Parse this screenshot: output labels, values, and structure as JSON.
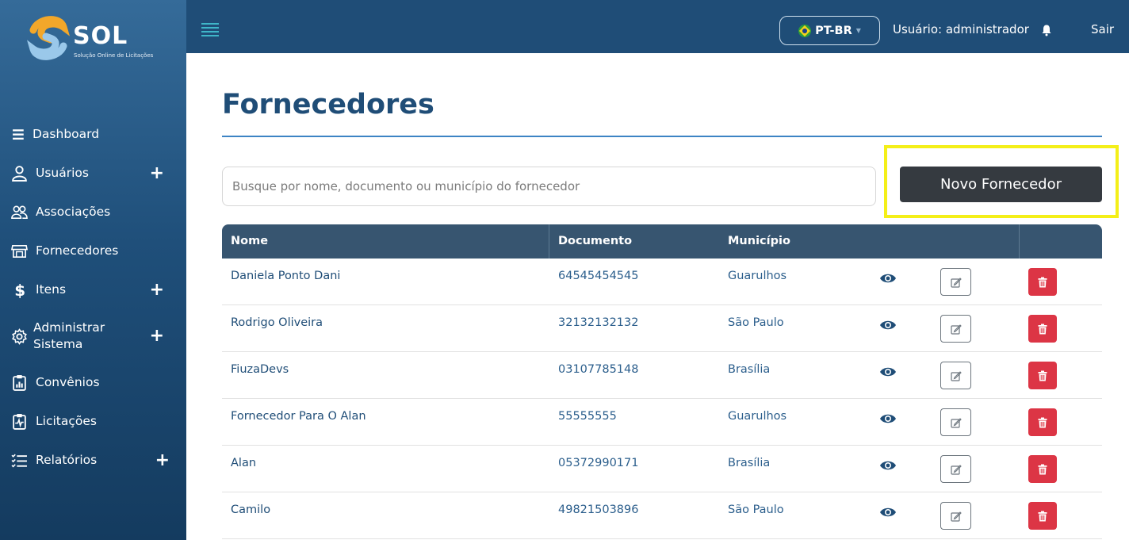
{
  "brand": {
    "name": "SOL",
    "tagline": "Solução Online de Licitações"
  },
  "sidebar": {
    "items": [
      {
        "label": "Dashboard",
        "icon": "bars-icon",
        "expandable": false
      },
      {
        "label": "Usuários",
        "icon": "user-icon",
        "expandable": true
      },
      {
        "label": "Associações",
        "icon": "users-icon",
        "expandable": false
      },
      {
        "label": "Fornecedores",
        "icon": "store-icon",
        "expandable": false
      },
      {
        "label": "Itens",
        "icon": "dollar-icon",
        "expandable": true
      },
      {
        "label": "Administrar\nSistema",
        "icon": "gear-icon",
        "expandable": true
      },
      {
        "label": "Convênios",
        "icon": "clipboard-chart-icon",
        "expandable": false
      },
      {
        "label": "Licitações",
        "icon": "clipboard-pulse-icon",
        "expandable": false
      },
      {
        "label": "Relatórios",
        "icon": "checklist-icon",
        "expandable": true
      }
    ],
    "expand_symbol": "+"
  },
  "header": {
    "language": "PT-BR",
    "user_label": "Usuário: administrador",
    "logout_label": "Sair"
  },
  "page": {
    "title": "Fornecedores",
    "search_placeholder": "Busque por nome, documento ou município do fornecedor",
    "new_button_label": "Novo Fornecedor"
  },
  "table": {
    "columns": [
      "Nome",
      "Documento",
      "Município"
    ],
    "rows": [
      {
        "name": "Daniela Ponto Dani",
        "document": "64545454545",
        "city": "Guarulhos"
      },
      {
        "name": "Rodrigo Oliveira",
        "document": "32132132132",
        "city": "São Paulo"
      },
      {
        "name": "FiuzaDevs",
        "document": "03107785148",
        "city": "Brasília"
      },
      {
        "name": "Fornecedor Para O Alan",
        "document": "55555555",
        "city": "Guarulhos"
      },
      {
        "name": "Alan",
        "document": "05372990171",
        "city": "Brasília"
      },
      {
        "name": "Camilo",
        "document": "49821503896",
        "city": "São Paulo"
      }
    ]
  },
  "colors": {
    "sidebar_top": "#356b99",
    "sidebar_bottom": "#143b5f",
    "header_bg": "#1f4d77",
    "table_header": "#375570",
    "primary_text": "#1f4d77",
    "new_button": "#353a40",
    "delete_button": "#dc3545",
    "highlight": "#f4ef18"
  }
}
